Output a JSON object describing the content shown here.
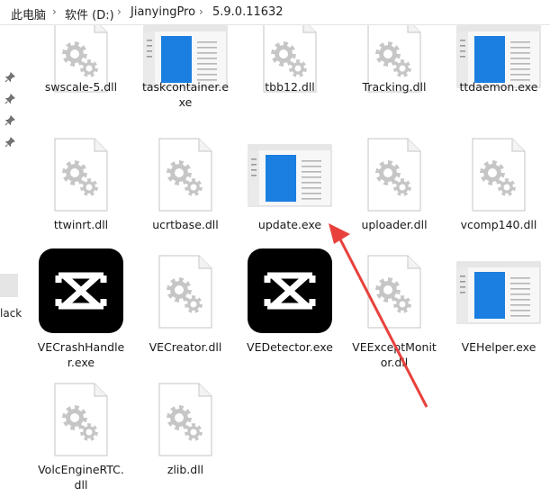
{
  "breadcrumb": [
    "此电脑",
    "软件 (D:)",
    "JianyingPro",
    "5.9.0.11632"
  ],
  "nav_partial_label": "lack",
  "rows": [
    {
      "items": [
        {
          "name": "swscale-5.dll",
          "icon": "gear-dll-icon",
          "lines": [
            "swscale-5.dll"
          ]
        },
        {
          "name": "taskcontainer.exe",
          "icon": "window-app-icon",
          "lines": [
            "taskcontainer.e",
            "xe"
          ]
        },
        {
          "name": "tbb12.dll",
          "icon": "gear-dll-icon",
          "lines": [
            "tbb12.dll"
          ]
        },
        {
          "name": "Tracking.dll",
          "icon": "gear-dll-icon",
          "lines": [
            "Tracking.dll"
          ]
        },
        {
          "name": "ttdaemon.exe",
          "icon": "window-app-icon",
          "lines": [
            "ttdaemon.exe"
          ]
        }
      ]
    },
    {
      "items": [
        {
          "name": "ttwinrt.dll",
          "icon": "gear-dll-icon",
          "lines": [
            "ttwinrt.dll"
          ]
        },
        {
          "name": "ucrtbase.dll",
          "icon": "gear-dll-icon",
          "lines": [
            "ucrtbase.dll"
          ]
        },
        {
          "name": "update.exe",
          "icon": "window-app-icon",
          "lines": [
            "update.exe"
          ]
        },
        {
          "name": "uploader.dll",
          "icon": "gear-dll-icon",
          "lines": [
            "uploader.dll"
          ]
        },
        {
          "name": "vcomp140.dll",
          "icon": "gear-dll-icon",
          "lines": [
            "vcomp140.dll"
          ]
        }
      ]
    },
    {
      "items": [
        {
          "name": "VECrashHandler.exe",
          "icon": "capcut-logo-icon",
          "lines": [
            "VECrashHandle",
            "r.exe"
          ]
        },
        {
          "name": "VECreator.dll",
          "icon": "gear-dll-icon",
          "lines": [
            "VECreator.dll"
          ]
        },
        {
          "name": "VEDetector.exe",
          "icon": "capcut-logo-icon",
          "lines": [
            "VEDetector.exe"
          ]
        },
        {
          "name": "VEExceptMonitor.dll",
          "icon": "gear-dll-icon",
          "lines": [
            "VEExceptMonit",
            "or.dll"
          ]
        },
        {
          "name": "VEHelper.exe",
          "icon": "window-app-icon",
          "lines": [
            "VEHelper.exe"
          ]
        }
      ]
    },
    {
      "items": [
        {
          "name": "VolcEngineRTC.dll",
          "icon": "gear-dll-icon",
          "lines": [
            "VolcEngineRTC.",
            "dll"
          ]
        },
        {
          "name": "zlib.dll",
          "icon": "gear-dll-icon",
          "lines": [
            "zlib.dll"
          ]
        }
      ]
    }
  ],
  "colors": {
    "annotation_arrow": "#e8413c",
    "app_blue": "#1a7fe0",
    "gear_gray": "#c6c6c6"
  }
}
